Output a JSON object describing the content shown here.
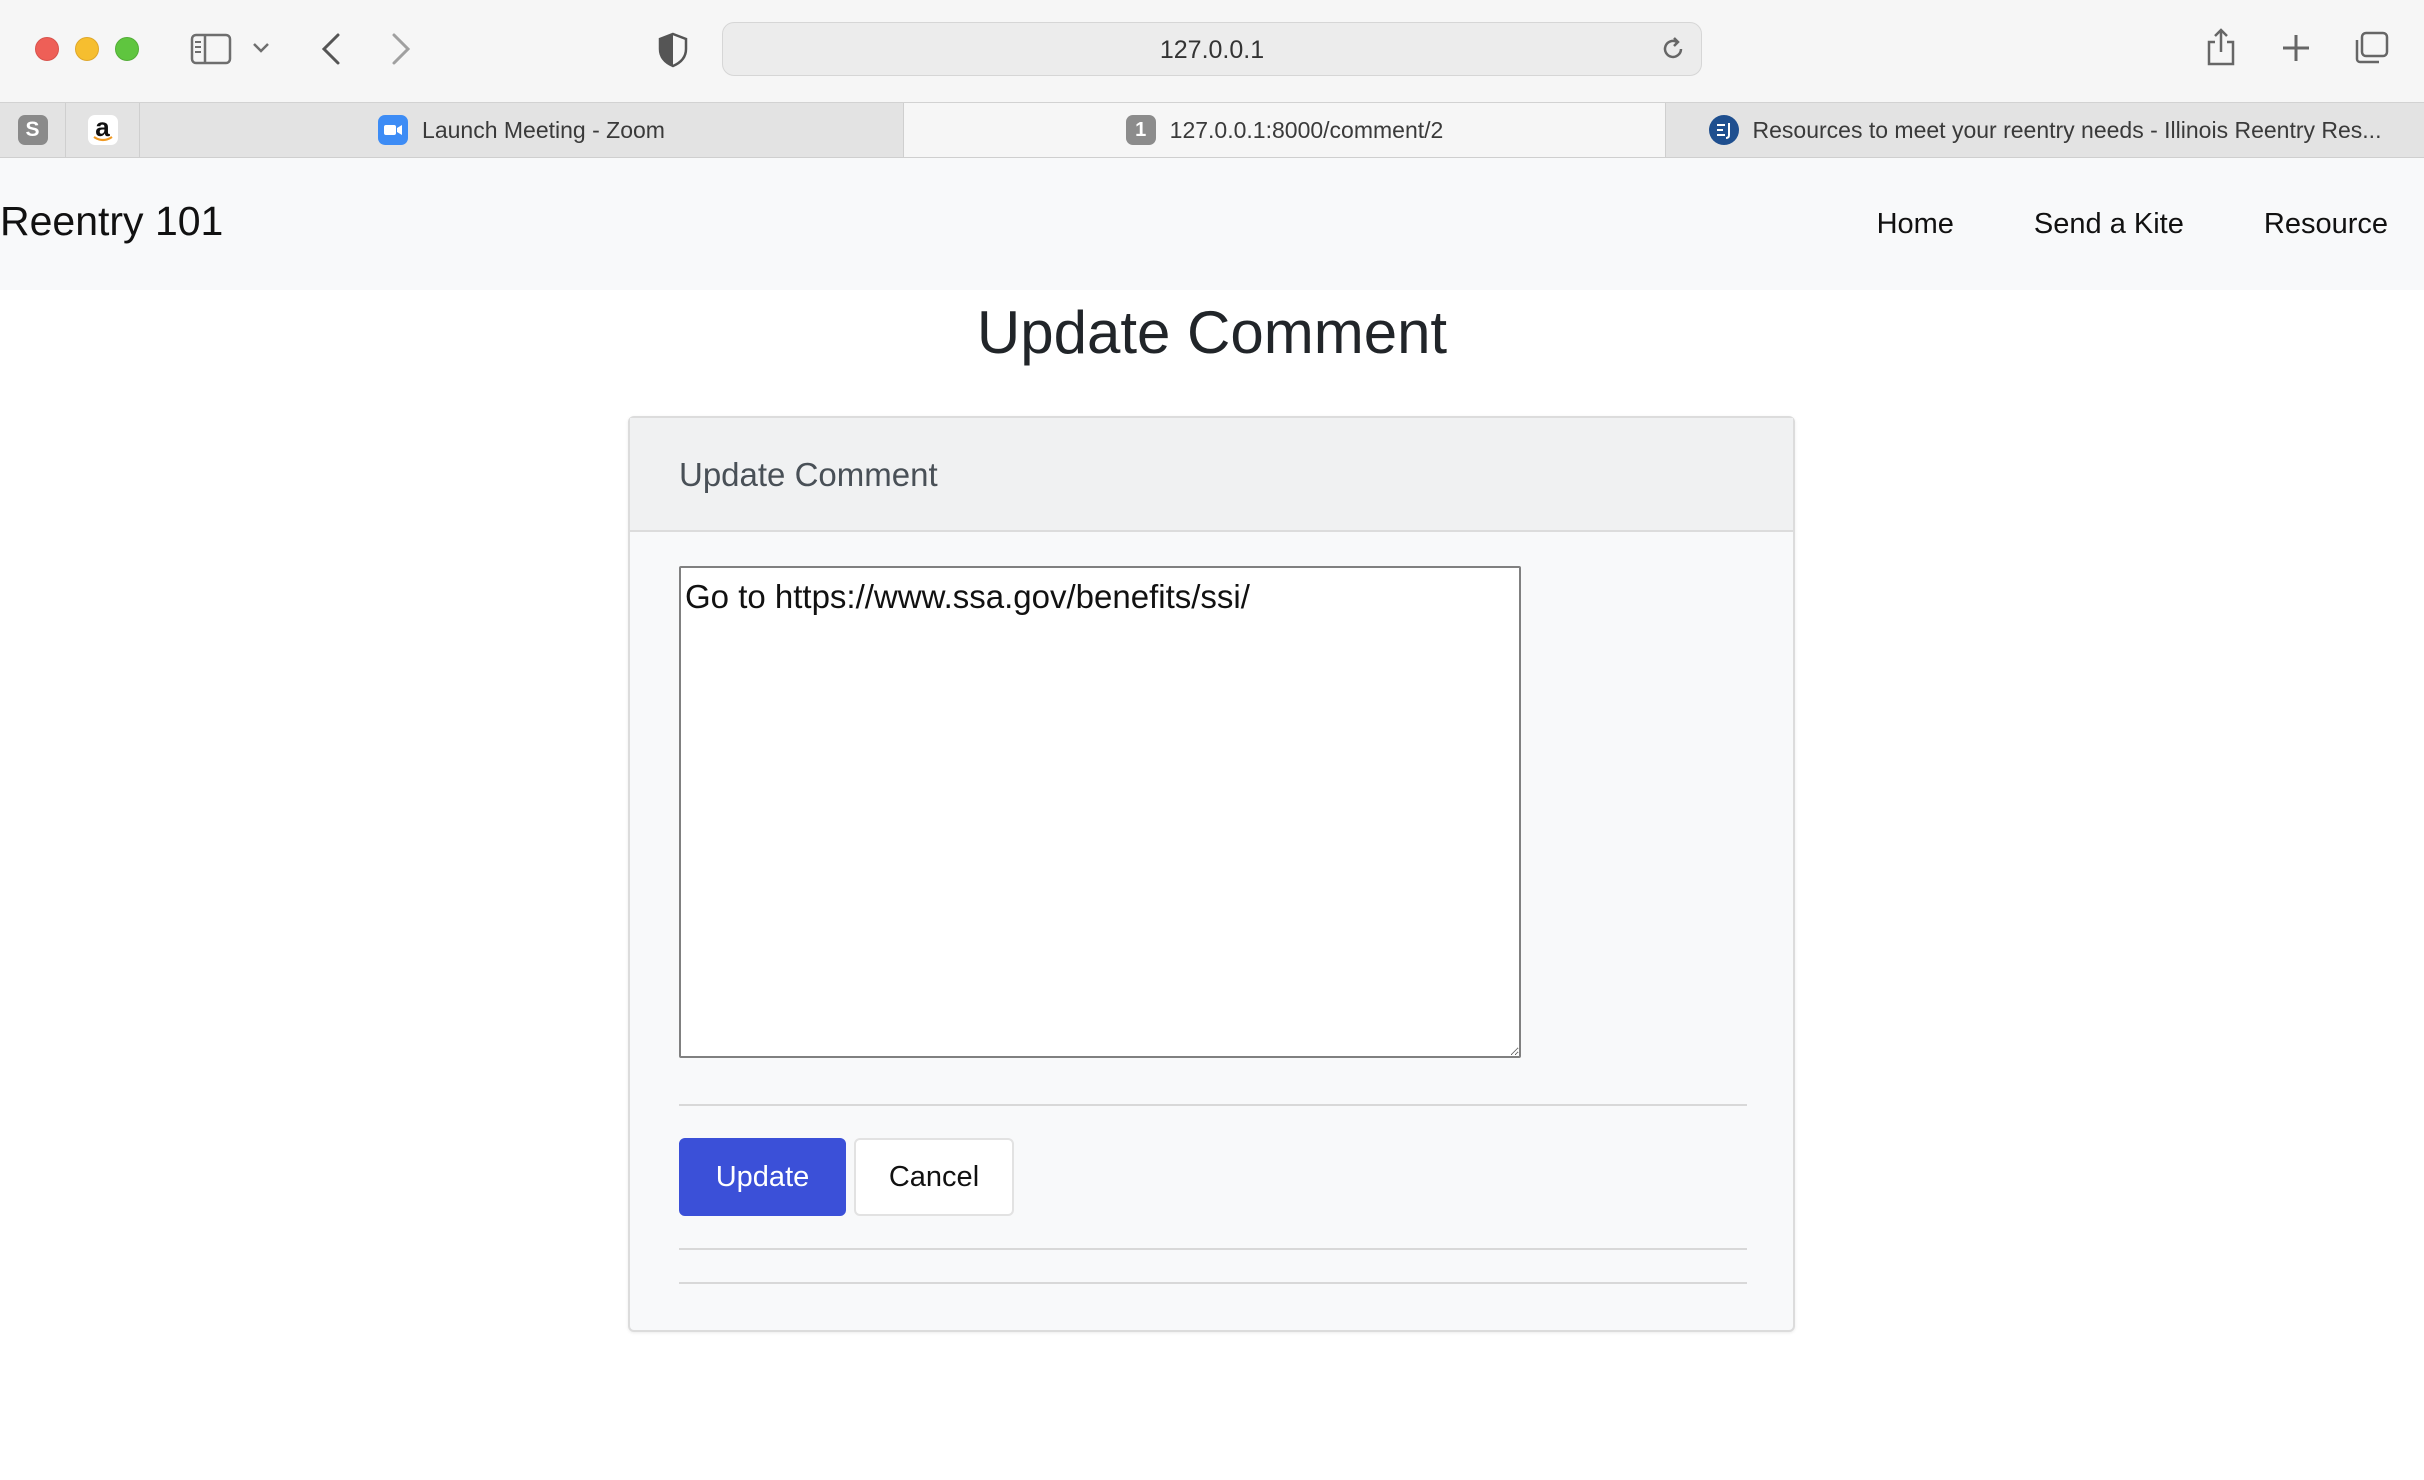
{
  "browser": {
    "url": "127.0.0.1",
    "pinned_tabs": [
      {
        "icon": "s-favicon",
        "glyph": "S"
      },
      {
        "icon": "amazon-favicon",
        "glyph": "a"
      }
    ],
    "tabs": [
      {
        "title": "Launch Meeting - Zoom",
        "icon": "zoom-favicon",
        "active": false
      },
      {
        "title": "127.0.0.1:8000/comment/2",
        "icon": "number-favicon",
        "glyph": "1",
        "active": true
      },
      {
        "title": "Resources to meet your reentry needs - Illinois Reentry Res...",
        "icon": "ejp-favicon",
        "active": false
      }
    ]
  },
  "navbar": {
    "brand": "Reentry 101",
    "links": [
      "Home",
      "Send a Kite",
      "Resource"
    ]
  },
  "page": {
    "title": "Update Comment"
  },
  "card": {
    "header": "Update Comment",
    "comment_text": "Go to https://www.ssa.gov/benefits/ssi/",
    "update_label": "Update",
    "cancel_label": "Cancel"
  },
  "colors": {
    "primary": "#3b50d8",
    "navbar_bg": "#f8f9fa"
  }
}
